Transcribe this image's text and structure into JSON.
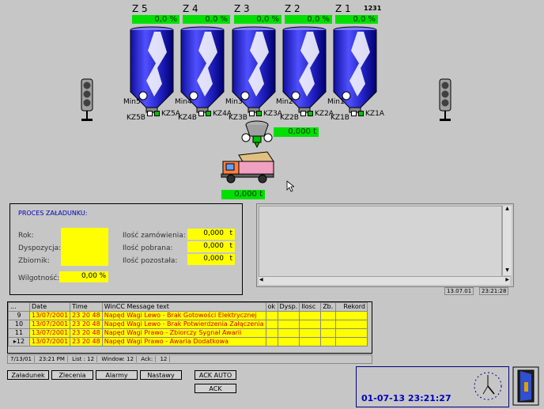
{
  "silos": [
    {
      "name": "Z 5",
      "value": "0,0 %",
      "min": "Min5",
      "kza": "KZ5A",
      "kzb": "KZ5B"
    },
    {
      "name": "Z 4",
      "value": "0,0 %",
      "min": "Min4",
      "kza": "KZ4A",
      "kzb": "KZ4B"
    },
    {
      "name": "Z 3",
      "value": "0,0 %",
      "min": "Min3",
      "kza": "KZ3A",
      "kzb": "KZ3B"
    },
    {
      "name": "Z 2",
      "value": "0,0 %",
      "min": "Min2",
      "kza": "KZ2A",
      "kzb": "KZ2B"
    },
    {
      "name": "Z 1",
      "value": "0,0 %",
      "min": "Min1",
      "kza": "KZ1A",
      "kzb": "KZ1B"
    }
  ],
  "silo1_code": "1231",
  "scale_value": "0,000 t",
  "truck_value": "0,000 t",
  "proces": {
    "title": "PROCES ZAŁADUNKU:",
    "rok": "Rok:",
    "dyspozycja": "Dyspozycja:",
    "zbiornik": "Zbiornik:",
    "wilgotnosc": "Wilgotność:",
    "wilgotnosc_value": "0,00",
    "wilgotnosc_unit": "%",
    "ilosc_zam": "Ilość zamówienia:",
    "ilosc_pob": "Ilość pobrana:",
    "ilosc_poz": "Ilość pozostała:",
    "zam_value": "0,000",
    "pob_value": "0,000",
    "poz_value": "0,000",
    "unit": "t"
  },
  "trend": {
    "date": "13.07.01",
    "time": "23:21:28"
  },
  "messages": {
    "headers": [
      "...",
      "Date",
      "Time",
      "WinCC Message text",
      "ok",
      "Dysp.",
      "Ilosc",
      "Zb.",
      "Rekord"
    ],
    "rows": [
      {
        "idx": "9",
        "date": "13/07/2001",
        "time": "23 20 48",
        "text": "Napęd Wagi Lewo - Brak Gotowości Elektrycznej"
      },
      {
        "idx": "10",
        "date": "13/07/2001",
        "time": "23 20 48",
        "text": "Napęd Wagi Lewo - Brak Potwierdzenia Załączenia"
      },
      {
        "idx": "11",
        "date": "13/07/2001",
        "time": "23 20 48",
        "text": "Napęd Wagi Prawo - Zbiorczy Sygnał Awarii"
      },
      {
        "idx": "12",
        "date": "13/07/2001",
        "time": "23 20 48",
        "text": "Napęd Wagi Prawo - Awaria Dodatkowa"
      }
    ],
    "status": [
      "7/13/01",
      "23:21 PM",
      "List : 12",
      "Window: 12",
      "Ack:",
      "12"
    ]
  },
  "buttons": {
    "zaladunek": "Załadunek",
    "zlecenia": "Zlecenia",
    "alarmy": "Alarmy",
    "nastawy": "Nastawy",
    "ack_auto": "ACK AUTO",
    "ack": "ACK"
  },
  "clock": "01-07-13 23:21:27"
}
